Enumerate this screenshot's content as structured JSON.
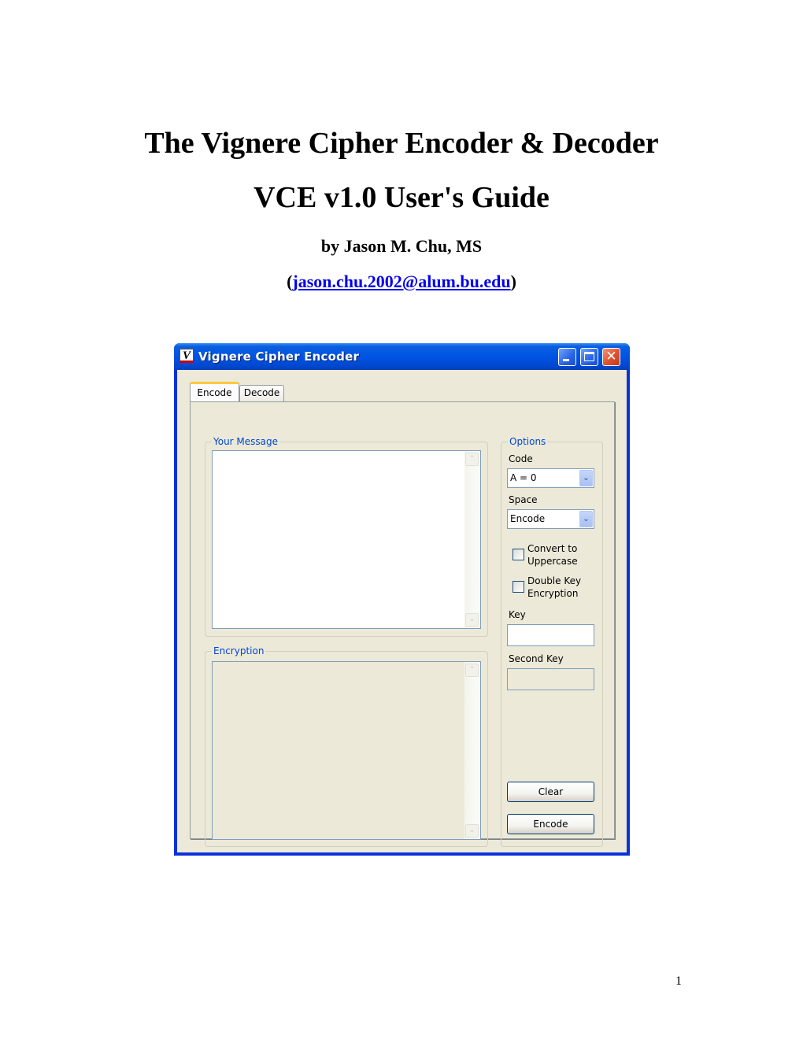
{
  "document": {
    "title_line1": "The Vignere Cipher Encoder & Decoder",
    "title_line2": "VCE v1.0 User's Guide",
    "author": "by Jason M. Chu, MS",
    "email_prefix": "(",
    "email": "jason.chu.2002@alum.bu.edu",
    "email_suffix": ")",
    "page_number": "1"
  },
  "window": {
    "title": "Vignere Cipher Encoder",
    "icon_glyph": "V",
    "controls": {
      "minimize": "minimize",
      "maximize": "maximize",
      "close": "✕"
    },
    "tabs": [
      {
        "label": "Encode",
        "active": true
      },
      {
        "label": "Decode",
        "active": false
      }
    ],
    "message_group": {
      "label": "Your Message",
      "value": ""
    },
    "encryption_group": {
      "label": "Encryption",
      "value": ""
    },
    "options": {
      "label": "Options",
      "code_label": "Code",
      "code_value": "A = 0",
      "space_label": "Space",
      "space_value": "Encode",
      "convert_uppercase_line1": "Convert to",
      "convert_uppercase_line2": "Uppercase",
      "convert_uppercase_checked": false,
      "double_key_line1": "Double Key",
      "double_key_line2": "Encryption",
      "double_key_checked": false,
      "key_label": "Key",
      "key_value": "",
      "second_key_label": "Second Key",
      "second_key_value": "",
      "clear_button": "Clear",
      "encode_button": "Encode"
    },
    "scroll_up_glyph": "⌃",
    "scroll_down_glyph": "⌄",
    "dropdown_glyph": "⌄"
  }
}
